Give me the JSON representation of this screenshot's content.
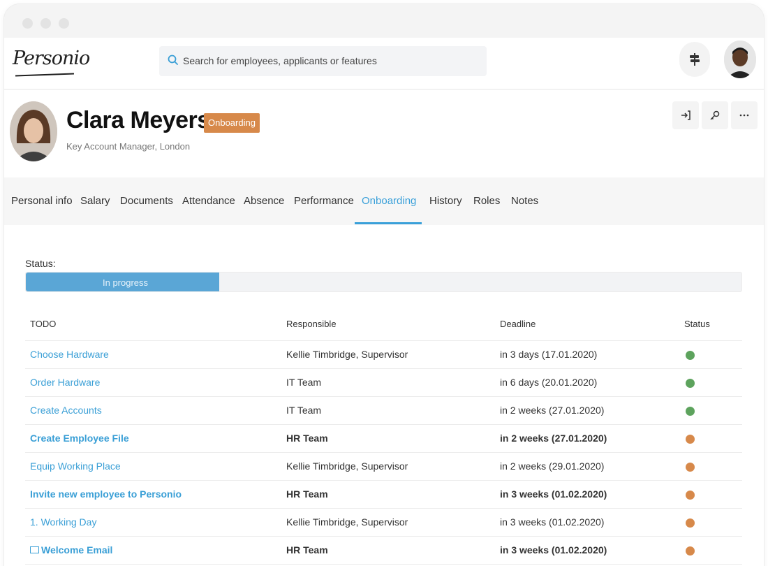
{
  "brand": {
    "logo_text": "Personio"
  },
  "search": {
    "placeholder": "Search for employees, applicants or features"
  },
  "profile": {
    "name": "Clara Meyers",
    "badge": "Onboarding",
    "subtitle": "Key Account Manager, London"
  },
  "tabs": [
    {
      "label": "Personal info",
      "active": false
    },
    {
      "label": "Salary",
      "active": false
    },
    {
      "label": "Documents",
      "active": false
    },
    {
      "label": "Attendance",
      "active": false
    },
    {
      "label": "Absence",
      "active": false
    },
    {
      "label": "Performance",
      "active": false
    },
    {
      "label": "Onboarding",
      "active": true
    },
    {
      "label": "History",
      "active": false
    },
    {
      "label": "Roles",
      "active": false
    },
    {
      "label": "Notes",
      "active": false
    }
  ],
  "onboarding": {
    "status_label": "Status:",
    "progress_text": "In progress",
    "progress_fraction": 0.27,
    "columns": {
      "todo": "TODO",
      "responsible": "Responsible",
      "deadline": "Deadline",
      "status": "Status"
    },
    "rows": [
      {
        "todo": "Choose Hardware",
        "responsible": "Kellie Timbridge, Supervisor",
        "deadline": "in 3 days (17.01.2020)",
        "status": "green",
        "bold": false
      },
      {
        "todo": "Order Hardware",
        "responsible": "IT Team",
        "deadline": "in 6 days (20.01.2020)",
        "status": "green",
        "bold": false
      },
      {
        "todo": "Create Accounts",
        "responsible": "IT Team",
        "deadline": "in 2 weeks (27.01.2020)",
        "status": "green",
        "bold": false
      },
      {
        "todo": "Create Employee File",
        "responsible": "HR Team",
        "deadline": "in 2 weeks (27.01.2020)",
        "status": "orange",
        "bold": true
      },
      {
        "todo": "Equip Working Place",
        "responsible": "Kellie Timbridge, Supervisor",
        "deadline": "in 2 weeks (29.01.2020)",
        "status": "orange",
        "bold": false
      },
      {
        "todo": "Invite new employee to Personio",
        "responsible": "HR Team",
        "deadline": "in 3 weeks (01.02.2020)",
        "status": "orange",
        "bold": true
      },
      {
        "todo": "1. Working Day",
        "responsible": "Kellie Timbridge, Supervisor",
        "deadline": "in 3 weeks (01.02.2020)",
        "status": "orange",
        "bold": false
      },
      {
        "todo": "Welcome Email",
        "responsible": "HR Team",
        "deadline": "in 3 weeks (01.02.2020)",
        "status": "orange",
        "bold": true,
        "icon": "mail-icon"
      }
    ]
  },
  "colors": {
    "accent": "#3aa0d9",
    "badge": "#d7894a",
    "status_green": "#5da35d",
    "status_orange": "#d7894a"
  }
}
